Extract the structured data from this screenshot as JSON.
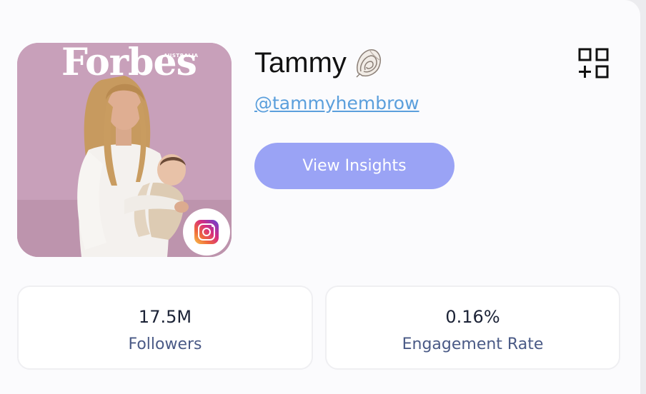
{
  "profile": {
    "name": "Tammy",
    "name_emoji_icon": "spiral-shell-icon",
    "handle": "@tammyhembrow",
    "platform_icon": "instagram-icon",
    "image": {
      "masthead": "Forbes",
      "masthead_region": "AUSTRALIA"
    }
  },
  "actions": {
    "view_insights_label": "View Insights",
    "add_widget_icon": "squares-plus-icon"
  },
  "stats": [
    {
      "value": "17.5M",
      "label": "Followers"
    },
    {
      "value": "0.16%",
      "label": "Engagement Rate"
    }
  ],
  "colors": {
    "accent_button": "#9aa3f5",
    "link": "#5b9fdc",
    "stat_label": "#4a5a86"
  }
}
